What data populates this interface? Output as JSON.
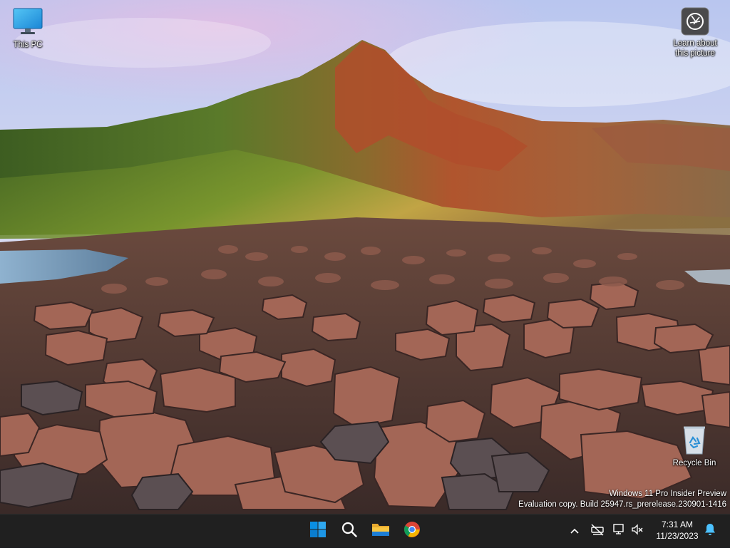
{
  "desktop": {
    "icons": {
      "this_pc": {
        "label": "This PC",
        "icon": "monitor-icon"
      },
      "learn": {
        "label_line1": "Learn about",
        "label_line2": "this picture",
        "icon": "camera-lens-icon"
      },
      "recycle_bin": {
        "label": "Recycle Bin",
        "icon": "recycle-bin-icon"
      }
    },
    "watermark": {
      "line1": "Windows 11 Pro Insider Preview",
      "line2": "Evaluation copy. Build 25947.rs_prerelease.230901-1416"
    }
  },
  "taskbar": {
    "pinned": [
      {
        "name": "Start",
        "icon": "windows-logo-icon"
      },
      {
        "name": "Search",
        "icon": "search-icon"
      },
      {
        "name": "File Explorer",
        "icon": "folder-icon"
      },
      {
        "name": "Google Chrome",
        "icon": "chrome-icon"
      }
    ],
    "tray": {
      "chevron_icon": "chevron-up-icon",
      "icons": [
        "network-drive-icon",
        "network-icon",
        "volume-muted-icon"
      ]
    },
    "clock": {
      "time": "7:31 AM",
      "date": "11/23/2023"
    },
    "notification_icon": "bell-icon"
  },
  "colors": {
    "taskbar_bg": "#202020",
    "windows_blue": "#0a8fe3",
    "notification_blue": "#4cc2ff"
  }
}
